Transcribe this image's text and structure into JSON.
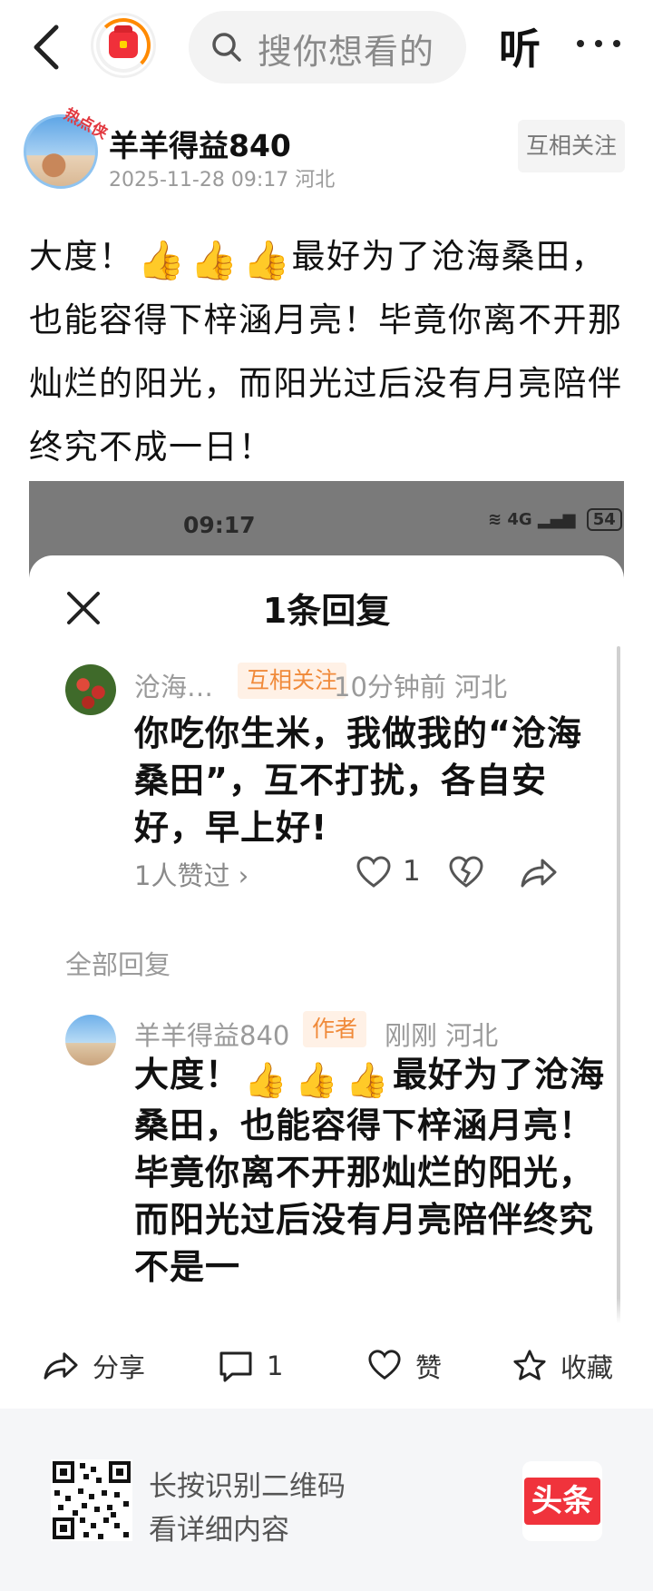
{
  "header": {
    "search_placeholder": "搜你想看的",
    "listen_label": "听"
  },
  "author": {
    "name": "羊羊得益840",
    "meta": "2025-11-28 09:17  河北",
    "follow_label": "互相关注",
    "avatar_badge": "热点侠"
  },
  "post": {
    "text_before": "大度！",
    "emoji": "👍",
    "text_after": "最好为了沧海桑田，也能容得下梓涵月亮！毕竟你离不开那灿烂的阳光，而阳光过后没有月亮陪伴终究不成一日！"
  },
  "screenshot": {
    "status_time": "09:17",
    "status_network": "4G",
    "battery": "54",
    "sheet_title": "1条回复",
    "comment": {
      "name": "沧海…",
      "tag": "互相关注",
      "time_location": "10分钟前  河北",
      "body": "你吃你生米，我做我的“沧海桑田”，互不打扰，各自安好，早上好!",
      "likes_text": "1人赞过 ›",
      "like_count": "1"
    },
    "all_replies_label": "全部回复",
    "reply": {
      "name": "羊羊得益840",
      "tag": "作者",
      "time_location": "刚刚  河北",
      "text_before": "大度！",
      "text_after": "最好为了沧海桑田，也能容得下梓涵月亮！毕竟你离不开那灿烂的阳光，而阳光过后没有月亮陪伴终究不是一"
    }
  },
  "actions": {
    "share_label": "分享",
    "comment_count": "1",
    "like_label": "赞",
    "collect_label": "收藏"
  },
  "footer": {
    "qr_line1": "长按识别二维码",
    "qr_line2": "看详细内容",
    "brand_label": "头条"
  },
  "colors": {
    "accent_red": "#f0333c",
    "tag_orange": "#f08a3a",
    "muted_gray": "#9a9a9a"
  }
}
